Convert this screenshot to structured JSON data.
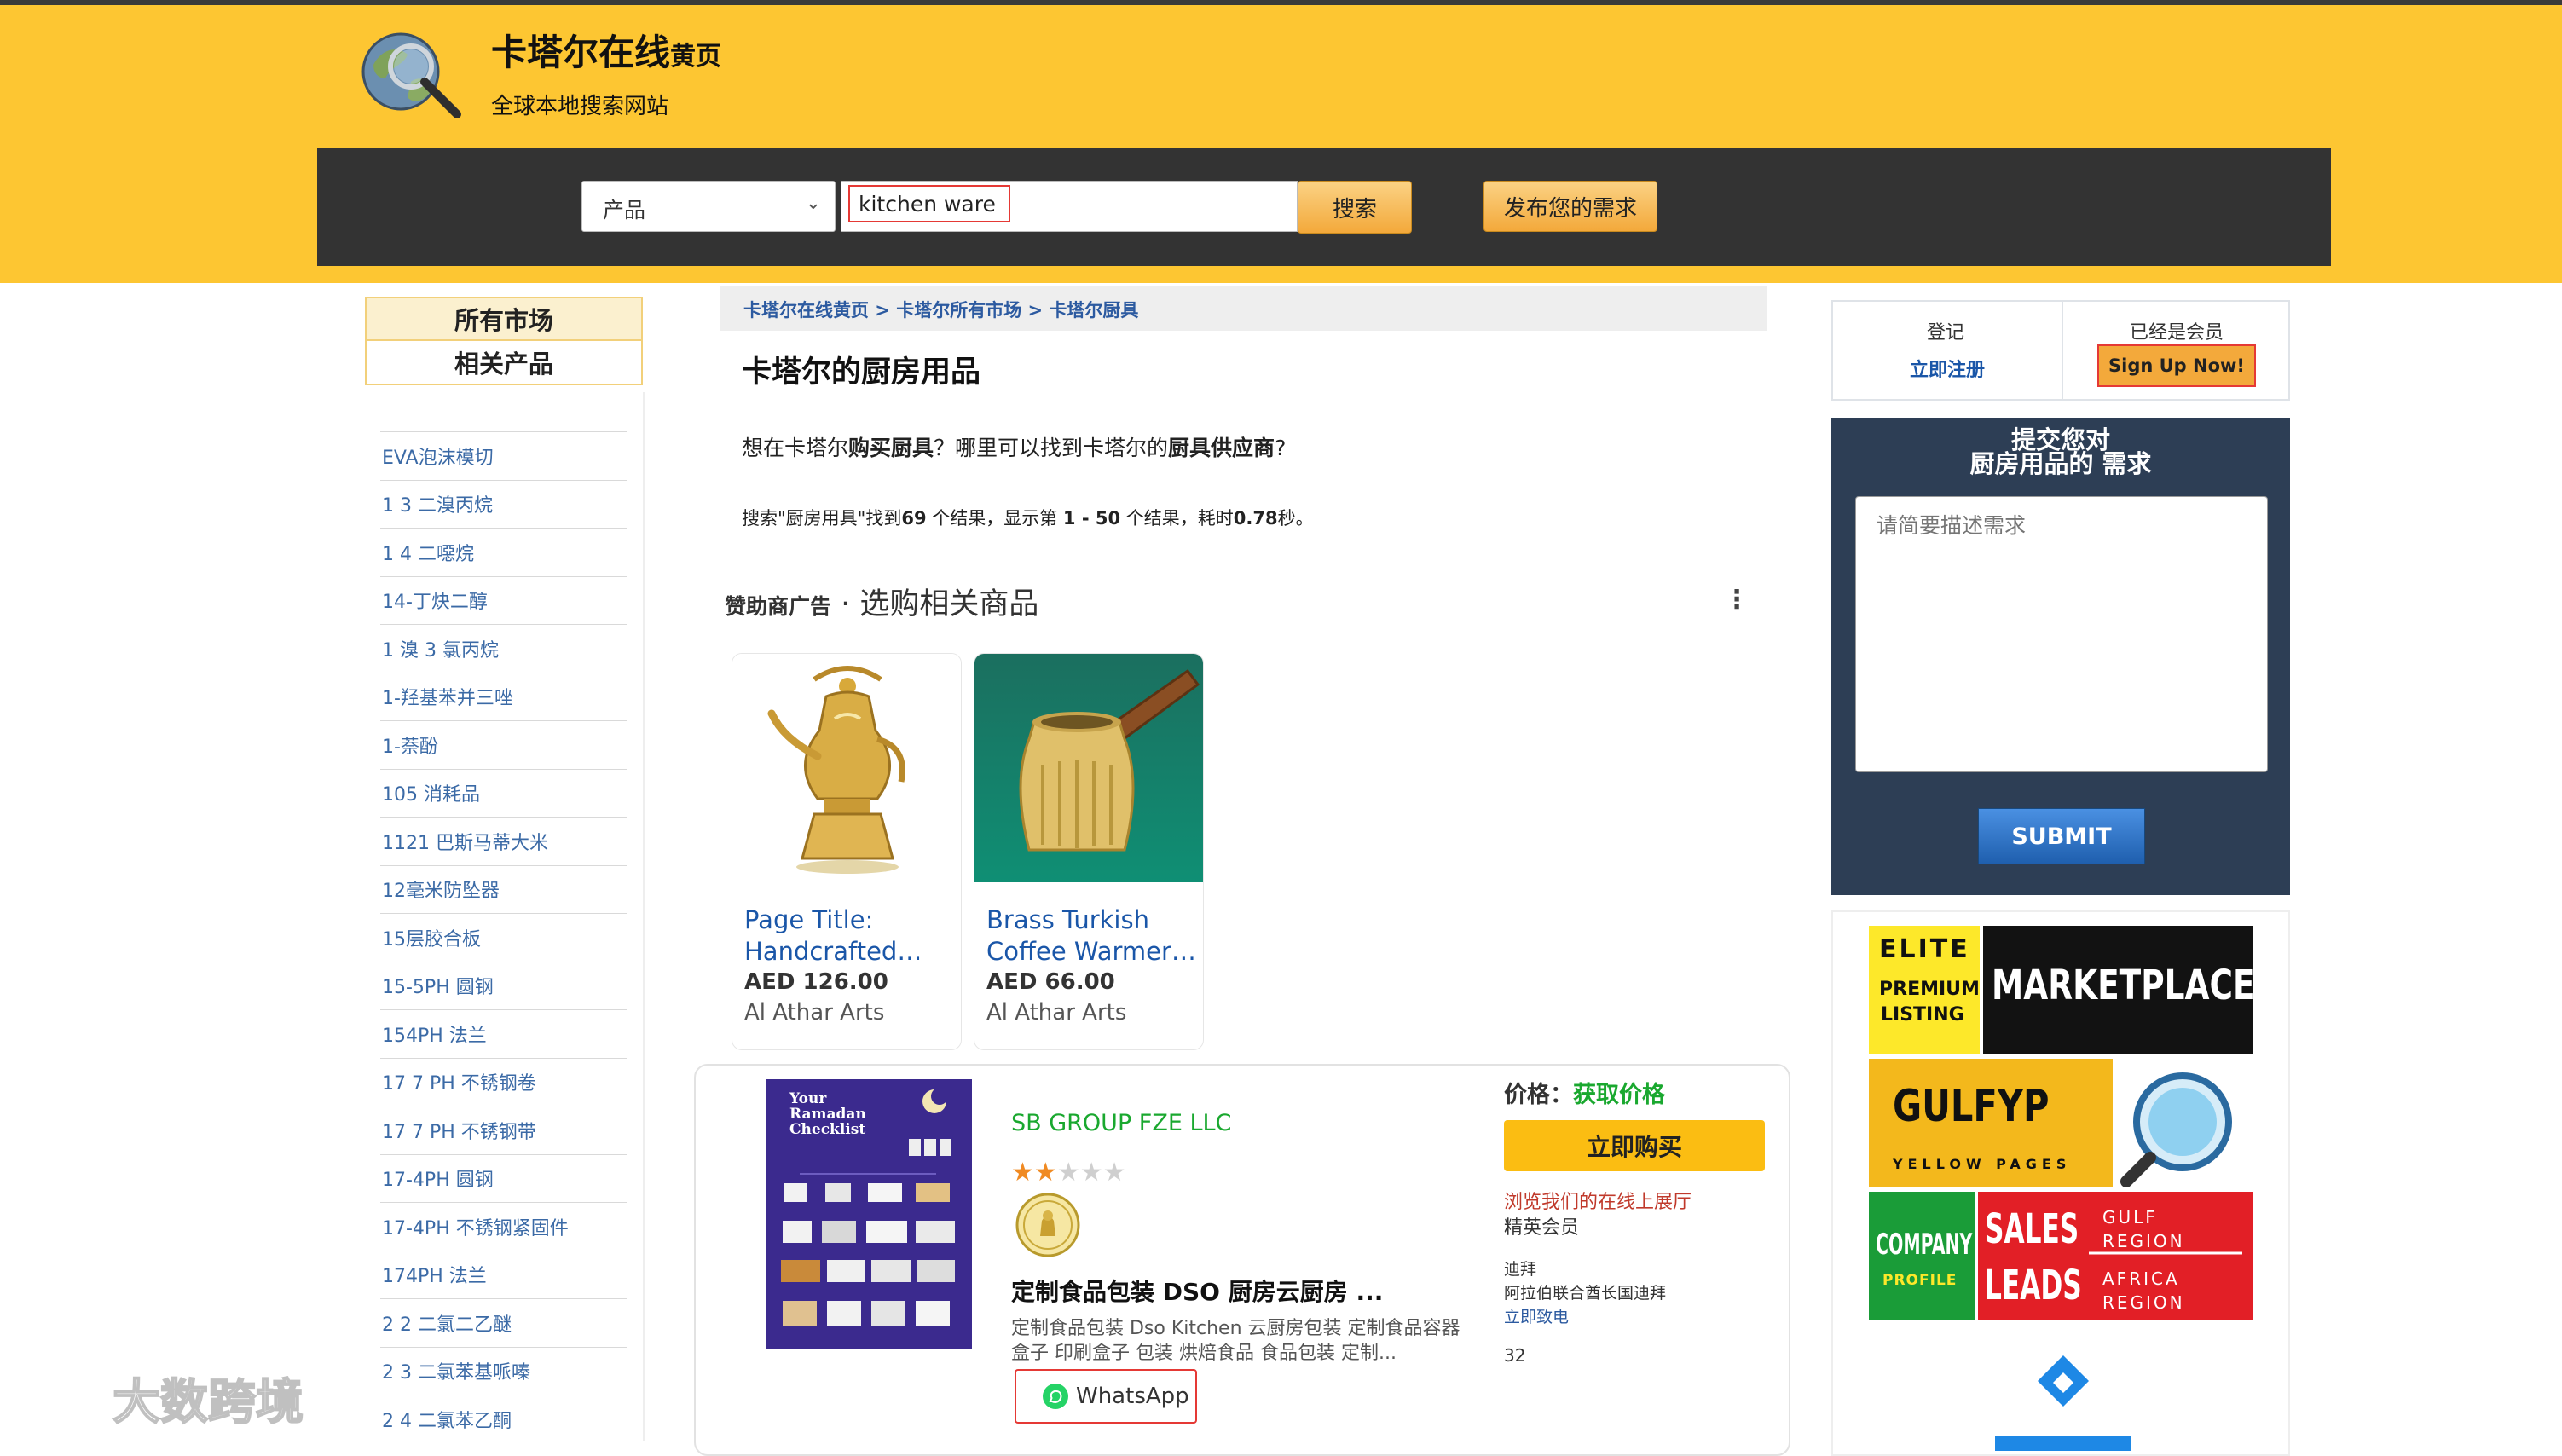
{
  "header": {
    "title_main": "卡塔尔在线",
    "title_suffix": "黄页",
    "subtitle": "全球本地搜索网站"
  },
  "search": {
    "category": "产品",
    "query": "kitchen ware",
    "search_label": "搜索",
    "post_label": "发布您的需求"
  },
  "sidebar": {
    "tabs": [
      "所有市场",
      "相关产品"
    ],
    "items": [
      "EVA泡沫模切",
      "1 3 二溴丙烷",
      "1 4 二噁烷",
      "14-丁炔二醇",
      "1 溴 3 氯丙烷",
      "1-羟基苯并三唑",
      "1-萘酚",
      "105 消耗品",
      "1121 巴斯马蒂大米",
      "12毫米防坠器",
      "15层胶合板",
      "15-5PH 圆钢",
      "154PH 法兰",
      "17 7 PH 不锈钢卷",
      "17 7 PH 不锈钢带",
      "17-4PH 圆钢",
      "17-4PH 不锈钢紧固件",
      "174PH 法兰",
      "2 2 二氯二乙醚",
      "2 3 二氯苯基哌嗪",
      "2 4 二氯苯乙酮"
    ]
  },
  "main": {
    "breadcrumb": "卡塔尔在线黄页 > 卡塔尔所有市场 > 卡塔尔厨具",
    "title": "卡塔尔的厨房用品",
    "intro": {
      "p1": "想在卡塔尔",
      "b1": "购买厨具",
      "p2": "？哪里可以找到卡塔尔的",
      "b2": "厨具供应商",
      "p3": "?"
    },
    "stats": {
      "p1": "搜索\"厨房用具\"找到",
      "b1": "69",
      "p2": " 个结果，显示第 ",
      "b2": "1 - 50",
      "p3": " 个结果，耗时",
      "b3": "0.78",
      "p4": "秒。"
    },
    "ads": {
      "label": "赞助商广告",
      "title": " · 选购相关商品",
      "menu_icon": "more-vert-icon",
      "products": [
        {
          "title": "Page Title: Handcrafted…",
          "price": "AED 126.00",
          "seller": "Al Athar Arts"
        },
        {
          "title": "Brass Turkish Coffee Warmer…",
          "price": "AED 66.00",
          "seller": "Al Athar Arts"
        }
      ]
    },
    "listing": {
      "thumb_line1": "Your",
      "thumb_line2": "Ramadan",
      "thumb_line3": "Checklist",
      "company": "SB GROUP FZE LLC",
      "rating": 2,
      "rating_max": 5,
      "title": "定制食品包装 DSO 厨房云厨房 ...",
      "desc": "定制食品包装 Dso Kitchen 云厨房包装 定制食品容器 盒子 印刷盒子 包装 烘焙食品 食品包装 定制...",
      "whatsapp": "WhatsApp",
      "price_label": "价格：",
      "price_value": "获取价格",
      "buy": "立即购买",
      "showroom": "浏览我们的在线上展厅",
      "member": "精英会员",
      "city": "迪拜",
      "region": "阿拉伯联合酋长国迪拜",
      "call": "立即致电",
      "count": "32"
    }
  },
  "right": {
    "login": "登记",
    "register": "立即注册",
    "member_prompt": "已经是会员",
    "signup": "Sign Up Now!",
    "request_title_1": "提交您对",
    "request_title_2": "厨房用品的 需求",
    "request_placeholder": "请简要描述需求",
    "submit": "SUBMIT",
    "promo": {
      "elite": "ELITE",
      "premium": "PREMIUM",
      "listing": "LISTING",
      "marketplace": "MARKETPLACE",
      "gulfyp": "GULFYP",
      "yellow_pages": "YELLOW PAGES",
      "company": "COMPANY",
      "profile": "PROFILE",
      "sales": "SALES",
      "leads": "LEADS",
      "gulf": "GULF",
      "region": "REGION",
      "africa": "AFRICA",
      "region2": "REGION"
    }
  },
  "watermark": "大数跨境",
  "colors": {
    "header_bg": "#fdc632",
    "search_bar": "#333333",
    "link_blue": "#1a56a8",
    "company_green": "#1aa82f",
    "buy_button": "#fbbd12",
    "request_panel": "#2d3e55"
  }
}
